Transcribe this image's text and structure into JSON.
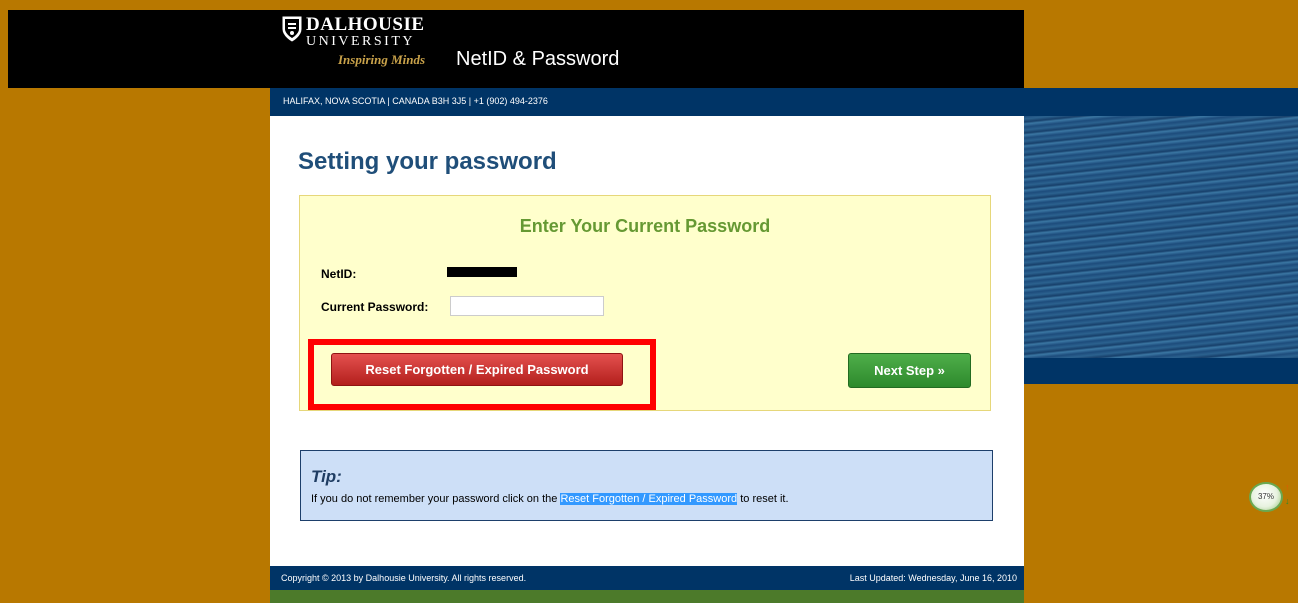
{
  "header": {
    "logo_name": "DALHOUSIE",
    "logo_university": "UNIVERSITY",
    "logo_tagline": "Inspiring Minds",
    "site_title": "NetID & Password",
    "address": "HALIFAX, NOVA SCOTIA | CANADA B3H 3J5 | +1 (902) 494-2376"
  },
  "main": {
    "page_title": "Setting your password",
    "form": {
      "heading": "Enter Your Current Password",
      "netid_label": "NetID:",
      "current_password_label": "Current Password:",
      "current_password_value": "",
      "reset_button": "Reset Forgotten / Expired Password",
      "next_button": "Next Step »"
    },
    "tip": {
      "title": "Tip:",
      "text_before": "If you do not remember your password click on the ",
      "link_text": "Reset Forgotten / Expired Password",
      "text_after": " to reset it."
    }
  },
  "footer": {
    "copyright": "Copyright © 2013 by Dalhousie University. All rights reserved.",
    "last_updated": "Last Updated: Wednesday, June 16, 2010"
  },
  "zoom_widget": {
    "percent": "37%",
    "up_arrow": "↑",
    "down_arrow": "↓"
  },
  "colors": {
    "background": "#b87800",
    "navy": "#003466",
    "title_blue": "#1f4e79",
    "heading_green": "#669933",
    "reset_red": "#c8302d",
    "next_green": "#3f9c3b",
    "highlight_red": "#ff0000"
  }
}
